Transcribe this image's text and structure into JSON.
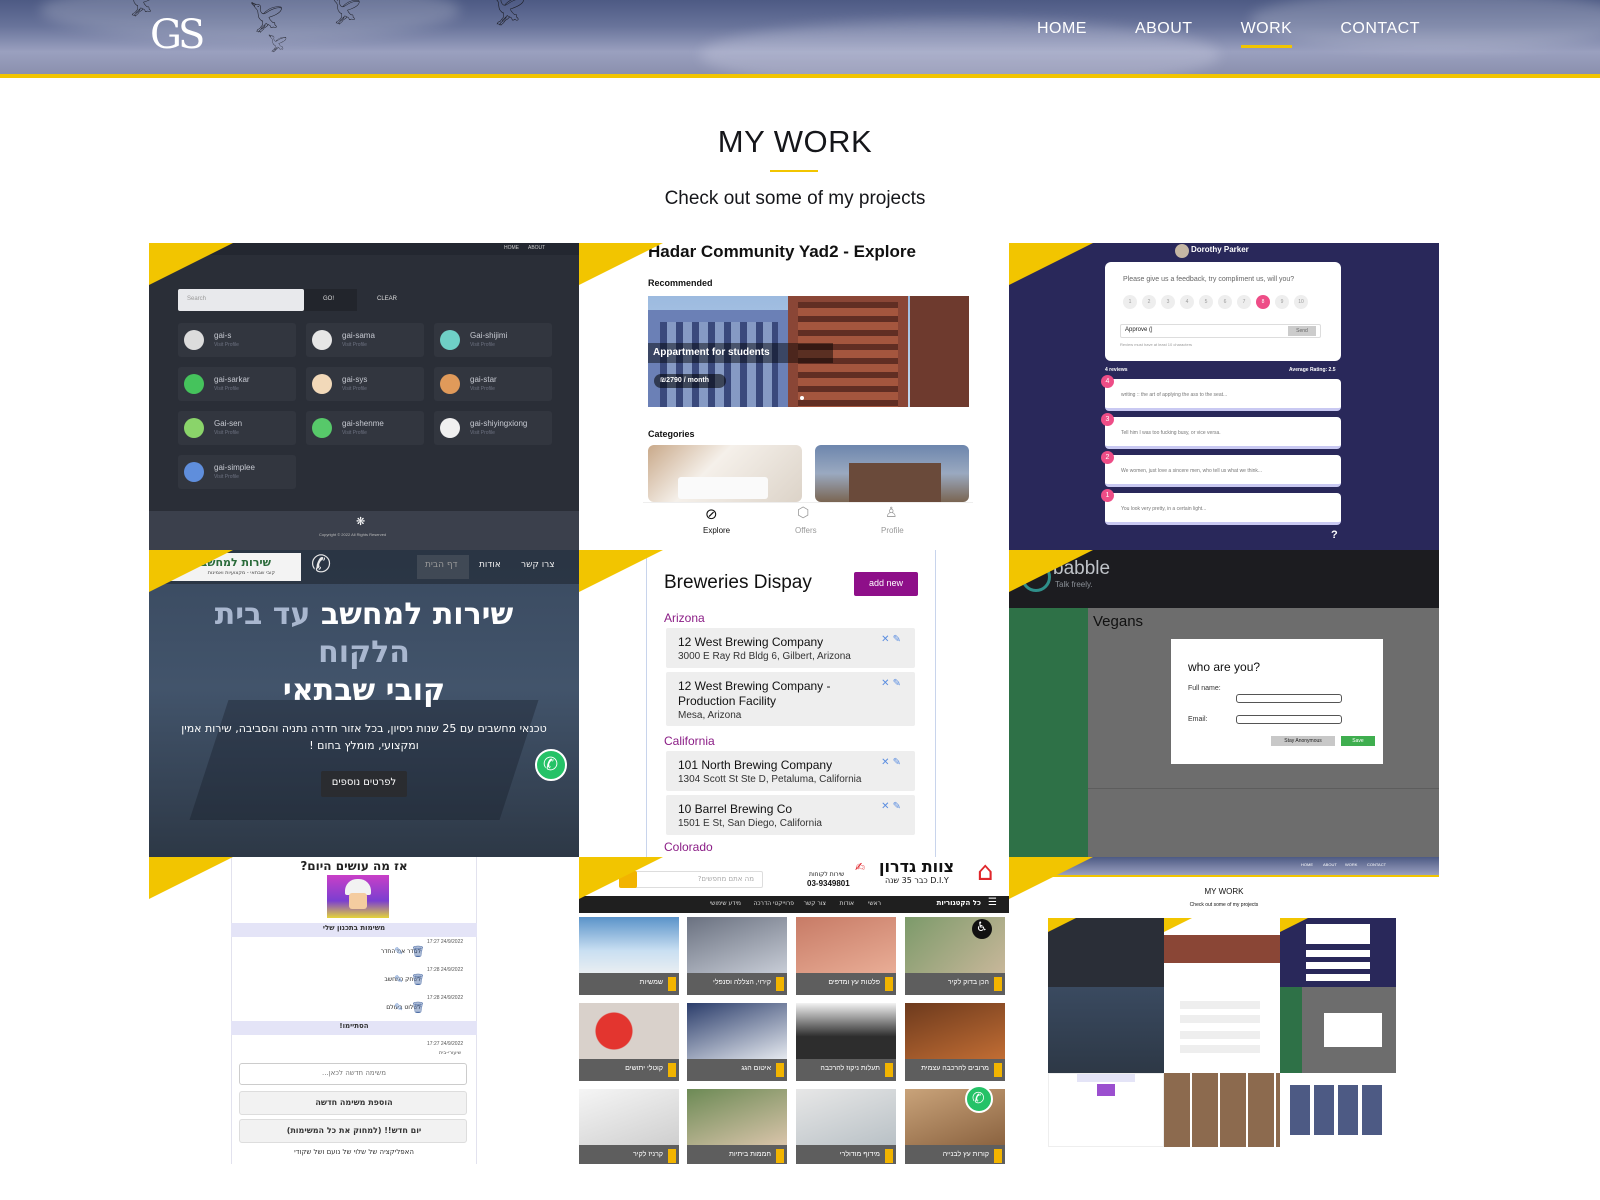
{
  "header": {
    "logo": "GS",
    "nav": [
      {
        "label": "HOME"
      },
      {
        "label": "ABOUT"
      },
      {
        "label": "WORK",
        "active": true
      },
      {
        "label": "CONTACT"
      }
    ],
    "accent_color": "#f2c500"
  },
  "section": {
    "title": "MY WORK",
    "subtitle": "Check out some of my projects"
  },
  "projects": [
    {
      "app": "github-finder",
      "nav": [
        "HOME",
        "ABOUT"
      ],
      "search_placeholder": "Search",
      "go_label": "GO!",
      "clear_label": "CLEAR",
      "users": [
        "gai-s",
        "gai-sama",
        "Gai-shijimi",
        "gai-sarkar",
        "gai-sys",
        "gai-star",
        "Gai-sen",
        "gai-shenme",
        "gai-shiyingxiong",
        "gai-simplee"
      ],
      "visit_label": "Visit Profile",
      "footer": "Copyright © 2022 All Rights Reserved"
    },
    {
      "title": "Hadar Community Yad2 - Explore",
      "recommended": "Recommended",
      "listing_title": "Appartment for students",
      "listing_price": "₪2790 / month",
      "categories": "Categories",
      "tabs": [
        "Explore",
        "Offers",
        "Profile"
      ]
    },
    {
      "user": "Dorothy Parker",
      "question": "Please give us a feedback, try compliment us, will you?",
      "scale": [
        "1",
        "2",
        "3",
        "4",
        "5",
        "6",
        "7",
        "8",
        "9",
        "10"
      ],
      "selected": "8",
      "input_value": "Approve (|",
      "send": "Send",
      "hint": "Review must have at least 10 characters",
      "reviews_count": "4 reviews",
      "average": "Average Rating: 2.5",
      "reviews": [
        {
          "n": "4",
          "text": "writing :: the art of applying the ass to the seat..."
        },
        {
          "n": "3",
          "text": "Tell him I was too fucking busy, or vice versa."
        },
        {
          "n": "2",
          "text": "We women, just love a sincere men, who tell us what we think..."
        },
        {
          "n": "1",
          "text": "You look very pretty, in a certain light..."
        }
      ]
    },
    {
      "brand": "שירות למחשב",
      "brand_sub": "קובי שבתאי - מקצועיות ואמינות",
      "nav": [
        "צרו קשר",
        "אודות",
        "דף הבית"
      ],
      "headline_a": "שירות למחשב",
      "headline_b": "עד בית",
      "headline_c": "הלקוח",
      "headline_d": "קובי שבתאי",
      "body": "טכנאי מחשבים עם 25 שנות ניסיון, בכל אזור חדרה נתניה והסביבה, שירות אמין ומקצועי, מומלץ בחום !",
      "cta": "לפרטים נוספים"
    },
    {
      "title": "Breweries Dispay",
      "add": "add new",
      "groups": [
        {
          "state": "Arizona",
          "items": [
            {
              "name": "12 West Brewing Company",
              "addr": "3000 E Ray Rd Bldg 6, Gilbert, Arizona"
            },
            {
              "name": "12 West Brewing Company - Production Facility",
              "addr": "Mesa, Arizona"
            }
          ]
        },
        {
          "state": "California",
          "items": [
            {
              "name": "101 North Brewing Company",
              "addr": "1304 Scott St Ste D, Petaluma, California"
            },
            {
              "name": "10 Barrel Brewing Co",
              "addr": "1501 E St, San Diego, California"
            }
          ]
        },
        {
          "state": "Colorado",
          "items": []
        }
      ]
    },
    {
      "brand": "babble",
      "tagline": "Talk freely.",
      "room": "Vegans",
      "modal_title": "who are you?",
      "field_name": "Full name:",
      "field_email": "Email:",
      "btn_anon": "Stay Anonymous",
      "btn_save": "Save"
    },
    {
      "header": "אז מה עושים היום?",
      "section_open": "משימות בתכנון שלי",
      "tasks": [
        {
          "time": "17:27 24/9/2022",
          "text": "לסדר את החדר"
        },
        {
          "time": "17:28 24/9/2022",
          "text": "לשחק כמחשב"
        },
        {
          "time": "17:28 24/9/2022",
          "text": "לשלוט בעולם"
        }
      ],
      "section_done": "הסתיימו!",
      "done_time": "17:27 24/9/2022",
      "done_text": "שיעורי-בית",
      "input_placeholder": "משימה חדשה לכאן...",
      "add_btn": "הוספת משימה חדשה",
      "clear_btn": "יום חדש!! (למחוק את כל המשימות)",
      "footer": "האפליקציה של שלוי של נועם ושל שקודי"
    },
    {
      "brand": "צוות גדרון",
      "brand_sub": "D.I.Y כבר 35 שנה",
      "phone_label": "שירות לקוחות",
      "phone": "03-9349801",
      "search_placeholder": "מה אתם מחפשים?",
      "categories_label": "כל הקטגוריות",
      "menu": [
        "ראשי",
        "אודות",
        "צור קשר",
        "פרוייקטי הדרכה",
        "מידע שימושי"
      ],
      "products": [
        "הכן בדוק לקיר",
        "פלטות עץ ומדפים",
        "קירוי, הצללה וסנפלי",
        "שמשיות",
        "מרובים להרכבה עצמית",
        "תעלות ניקוז להרכבה",
        "איטום הגג",
        "קוטלי יתושים",
        "קורות עץ לבנייה",
        "מידוף מודולרי",
        "חממות ביתיות",
        "קרניז לקיר"
      ]
    },
    {
      "mini_title": "MY WORK",
      "mini_sub": "Check out some of my projects",
      "mini_nav": [
        "HOME",
        "ABOUT",
        "WORK",
        "CONTACT"
      ]
    }
  ]
}
